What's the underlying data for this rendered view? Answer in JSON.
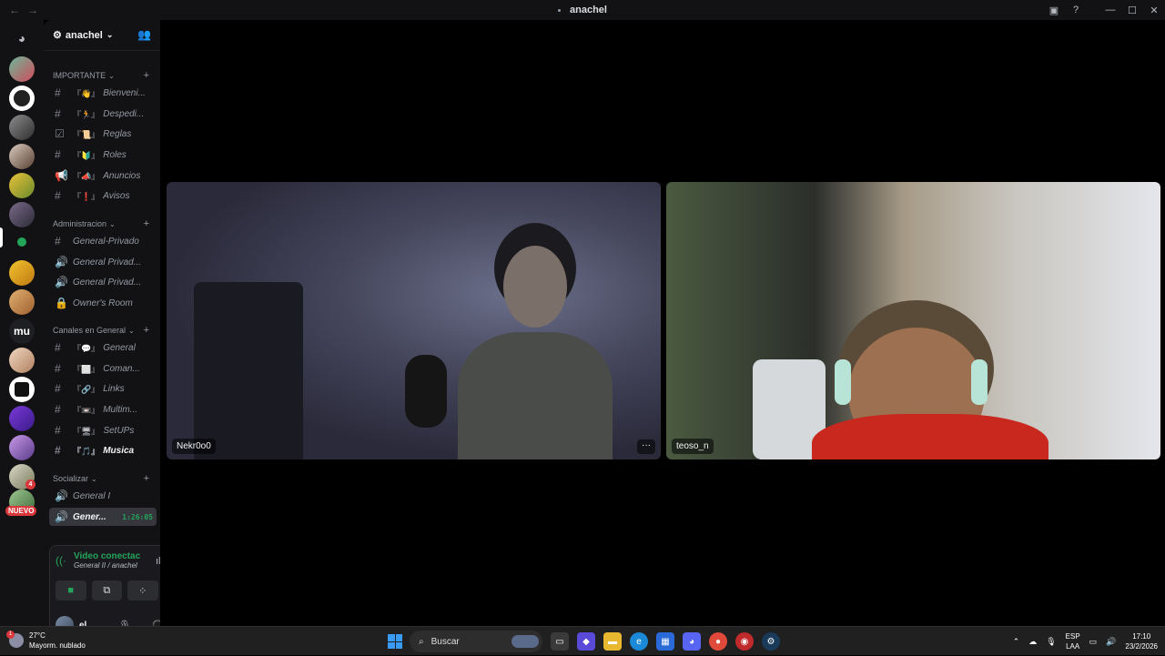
{
  "window": {
    "title": "anachel"
  },
  "server": {
    "name": "anachel"
  },
  "guilds": {
    "nuevo_label": "NUEVO",
    "mu_label": "mu",
    "badge": "4"
  },
  "categories": [
    {
      "name": "IMPORTANTE"
    },
    {
      "name": "Administracion"
    },
    {
      "name": "Canales en General"
    },
    {
      "name": "Socializar"
    }
  ],
  "channels": {
    "importante": [
      {
        "icon": "#",
        "emoji": "『👋』",
        "label": "Bienveni..."
      },
      {
        "icon": "#",
        "emoji": "『🏃』",
        "label": "Despedi..."
      },
      {
        "icon": "☑",
        "emoji": "『📜』",
        "label": "Reglas"
      },
      {
        "icon": "#",
        "emoji": "『🔰』",
        "label": "Roles"
      },
      {
        "icon": "📢",
        "emoji": "『📣』",
        "label": "Anuncios"
      },
      {
        "icon": "#",
        "emoji": "『❗』",
        "label": "Avisos"
      }
    ],
    "admin": [
      {
        "icon": "#",
        "label": "General-Privado"
      },
      {
        "icon": "🔊",
        "label": "General Privad..."
      },
      {
        "icon": "🔊",
        "label": "General Privad..."
      },
      {
        "icon": "🔒",
        "label": "Owner's Room"
      }
    ],
    "general": [
      {
        "icon": "#",
        "emoji": "『💬』",
        "label": "General"
      },
      {
        "icon": "#",
        "emoji": "『⬜』",
        "label": "Coman..."
      },
      {
        "icon": "#",
        "emoji": "『🔗』",
        "label": "Links"
      },
      {
        "icon": "#",
        "emoji": "『📼』",
        "label": "Multim..."
      },
      {
        "icon": "#",
        "emoji": "『🖥』",
        "label": "SetUPs"
      },
      {
        "icon": "#",
        "emoji": "『🎵』",
        "label": "Musica"
      }
    ],
    "socializar": [
      {
        "icon": "🔊",
        "label": "General I"
      },
      {
        "icon": "🔊",
        "label": "Gener...",
        "timer": "1:26:05"
      }
    ]
  },
  "voice_panel": {
    "status": "Video conectac",
    "location": "General II / anachel"
  },
  "user": {
    "name": "el...",
    "status": ""
  },
  "tiles": [
    {
      "name": "Nekr0o0"
    },
    {
      "name": "teoso_n"
    }
  ],
  "taskbar": {
    "temp": "27°C",
    "weather": "Mayorm. nublado",
    "weather_badge": "1",
    "search": "Buscar",
    "lang1": "ESP",
    "lang2": "LAA",
    "time": "17:10",
    "date": "23/2/2026"
  },
  "colors": {
    "accent_green": "#23a55a",
    "bg": "#121214",
    "danger": "#da373c"
  }
}
